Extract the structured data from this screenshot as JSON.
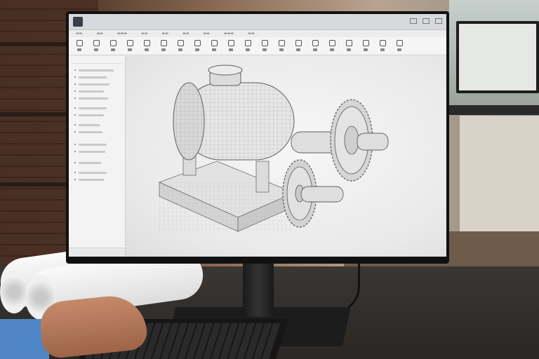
{
  "colors": {
    "screen_bg": "#efefef",
    "monitor_bezel": "#111111",
    "sleeve": "#4f86c6",
    "desk": "#2f2b29"
  },
  "icons": [
    "app-logo-icon",
    "minimize-icon",
    "maximize-icon",
    "close-icon"
  ],
  "scene": {
    "objects": [
      "monitor",
      "cad-application-window",
      "blueprint-rolls",
      "keyboard",
      "hand",
      "desk"
    ]
  }
}
